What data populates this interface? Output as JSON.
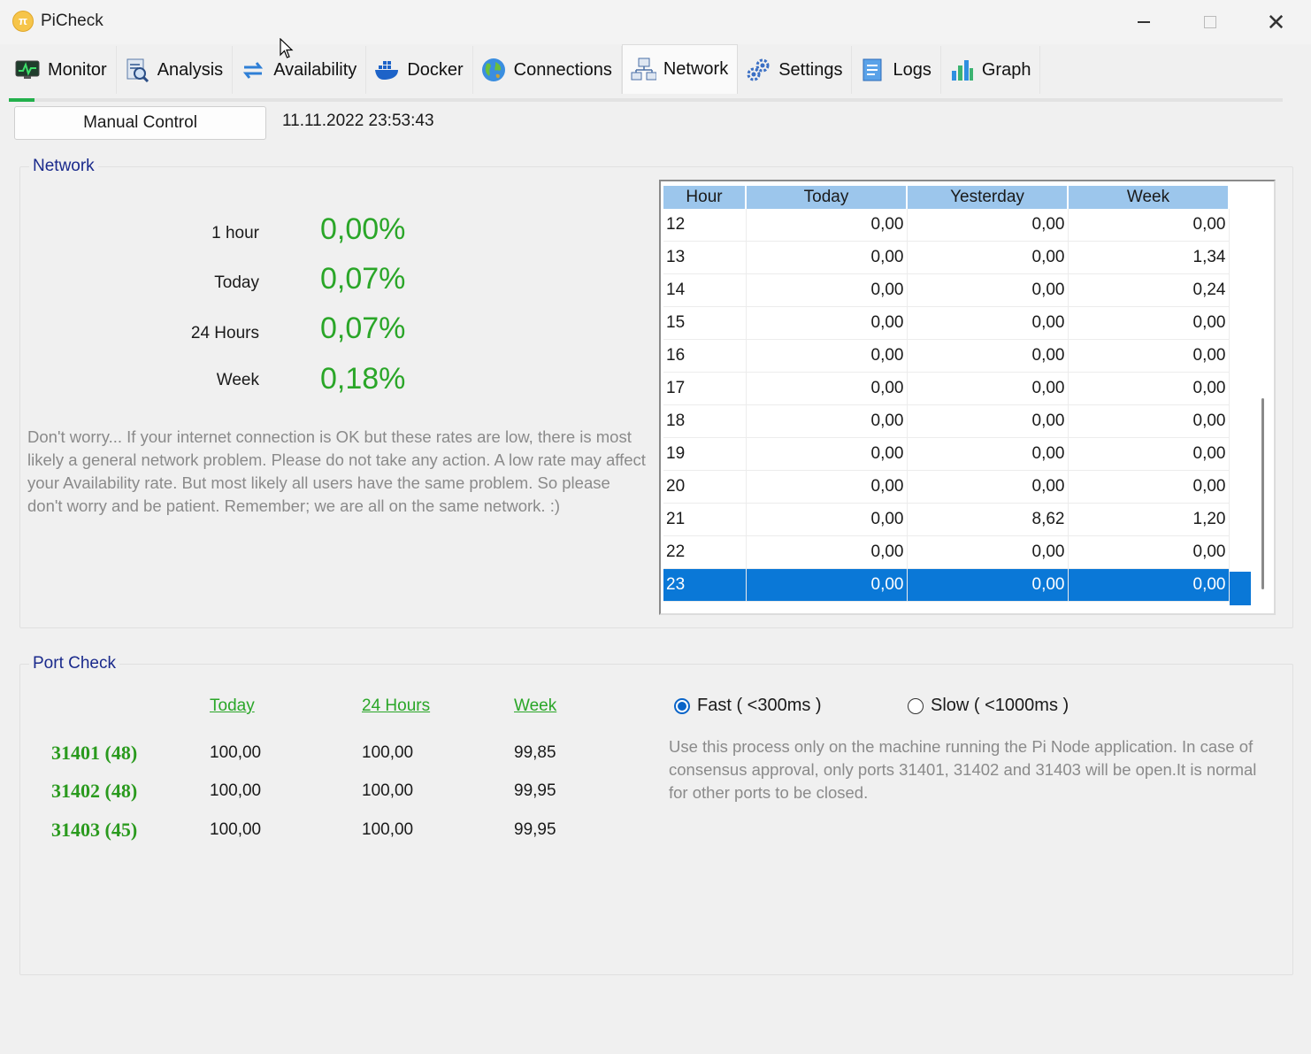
{
  "window": {
    "title": "PiCheck"
  },
  "tabs": [
    {
      "label": "Monitor",
      "icon": "monitor-icon"
    },
    {
      "label": "Analysis",
      "icon": "analysis-icon"
    },
    {
      "label": "Availability",
      "icon": "availability-icon"
    },
    {
      "label": "Docker",
      "icon": "docker-icon"
    },
    {
      "label": "Connections",
      "icon": "globe-icon"
    },
    {
      "label": "Network",
      "icon": "network-icon"
    },
    {
      "label": "Settings",
      "icon": "gears-icon"
    },
    {
      "label": "Logs",
      "icon": "logs-icon"
    },
    {
      "label": "Graph",
      "icon": "bar-chart-icon"
    }
  ],
  "active_tab": "Network",
  "toolbar": {
    "manual_control": "Manual Control",
    "datetime": "11.11.2022 23:53:43"
  },
  "network": {
    "title": "Network",
    "rates": [
      {
        "label": "1 hour",
        "value": "0,00%"
      },
      {
        "label": "Today",
        "value": "0,07%"
      },
      {
        "label": "24 Hours",
        "value": "0,07%"
      },
      {
        "label": "Week",
        "value": "0,18%"
      }
    ],
    "note": "Don't worry... If your internet connection is OK but these rates are low, there is most likely a general network problem. Please do not take any action. A low rate may affect your Availability rate. But most likely all users have the same problem. So please don't worry and be patient. Remember; we are all on the same network. :)"
  },
  "hour_table": {
    "columns": [
      "Hour",
      "Today",
      "Yesterday",
      "Week"
    ],
    "rows": [
      [
        "12",
        "0,00",
        "0,00",
        "0,00"
      ],
      [
        "13",
        "0,00",
        "0,00",
        "1,34"
      ],
      [
        "14",
        "0,00",
        "0,00",
        "0,24"
      ],
      [
        "15",
        "0,00",
        "0,00",
        "0,00"
      ],
      [
        "16",
        "0,00",
        "0,00",
        "0,00"
      ],
      [
        "17",
        "0,00",
        "0,00",
        "0,00"
      ],
      [
        "18",
        "0,00",
        "0,00",
        "0,00"
      ],
      [
        "19",
        "0,00",
        "0,00",
        "0,00"
      ],
      [
        "20",
        "0,00",
        "0,00",
        "0,00"
      ],
      [
        "21",
        "0,00",
        "8,62",
        "1,20"
      ],
      [
        "22",
        "0,00",
        "0,00",
        "0,00"
      ],
      [
        "23",
        "0,00",
        "0,00",
        "0,00"
      ]
    ],
    "selected_row": 11
  },
  "port_check": {
    "title": "Port Check",
    "headers": [
      "Today",
      "24 Hours",
      "Week"
    ],
    "ports": [
      {
        "port": "31401 (48)",
        "values": [
          "100,00",
          "100,00",
          "99,85"
        ]
      },
      {
        "port": "31402 (48)",
        "values": [
          "100,00",
          "100,00",
          "99,95"
        ]
      },
      {
        "port": "31403 (45)",
        "values": [
          "100,00",
          "100,00",
          "99,95"
        ]
      }
    ],
    "speed_options": [
      {
        "label": "Fast ( <300ms )",
        "selected": true
      },
      {
        "label": "Slow ( <1000ms )",
        "selected": false
      }
    ],
    "note": "Use this process only on the machine running the Pi Node application. In case of consensus approval, only ports 31401, 31402 and 31403 will be open.It is normal for other ports to be closed."
  },
  "colors": {
    "accent_green": "#2aa628",
    "group_title": "#1a2a8c",
    "selection": "#0a78d7",
    "header": "#9cc6ec"
  }
}
